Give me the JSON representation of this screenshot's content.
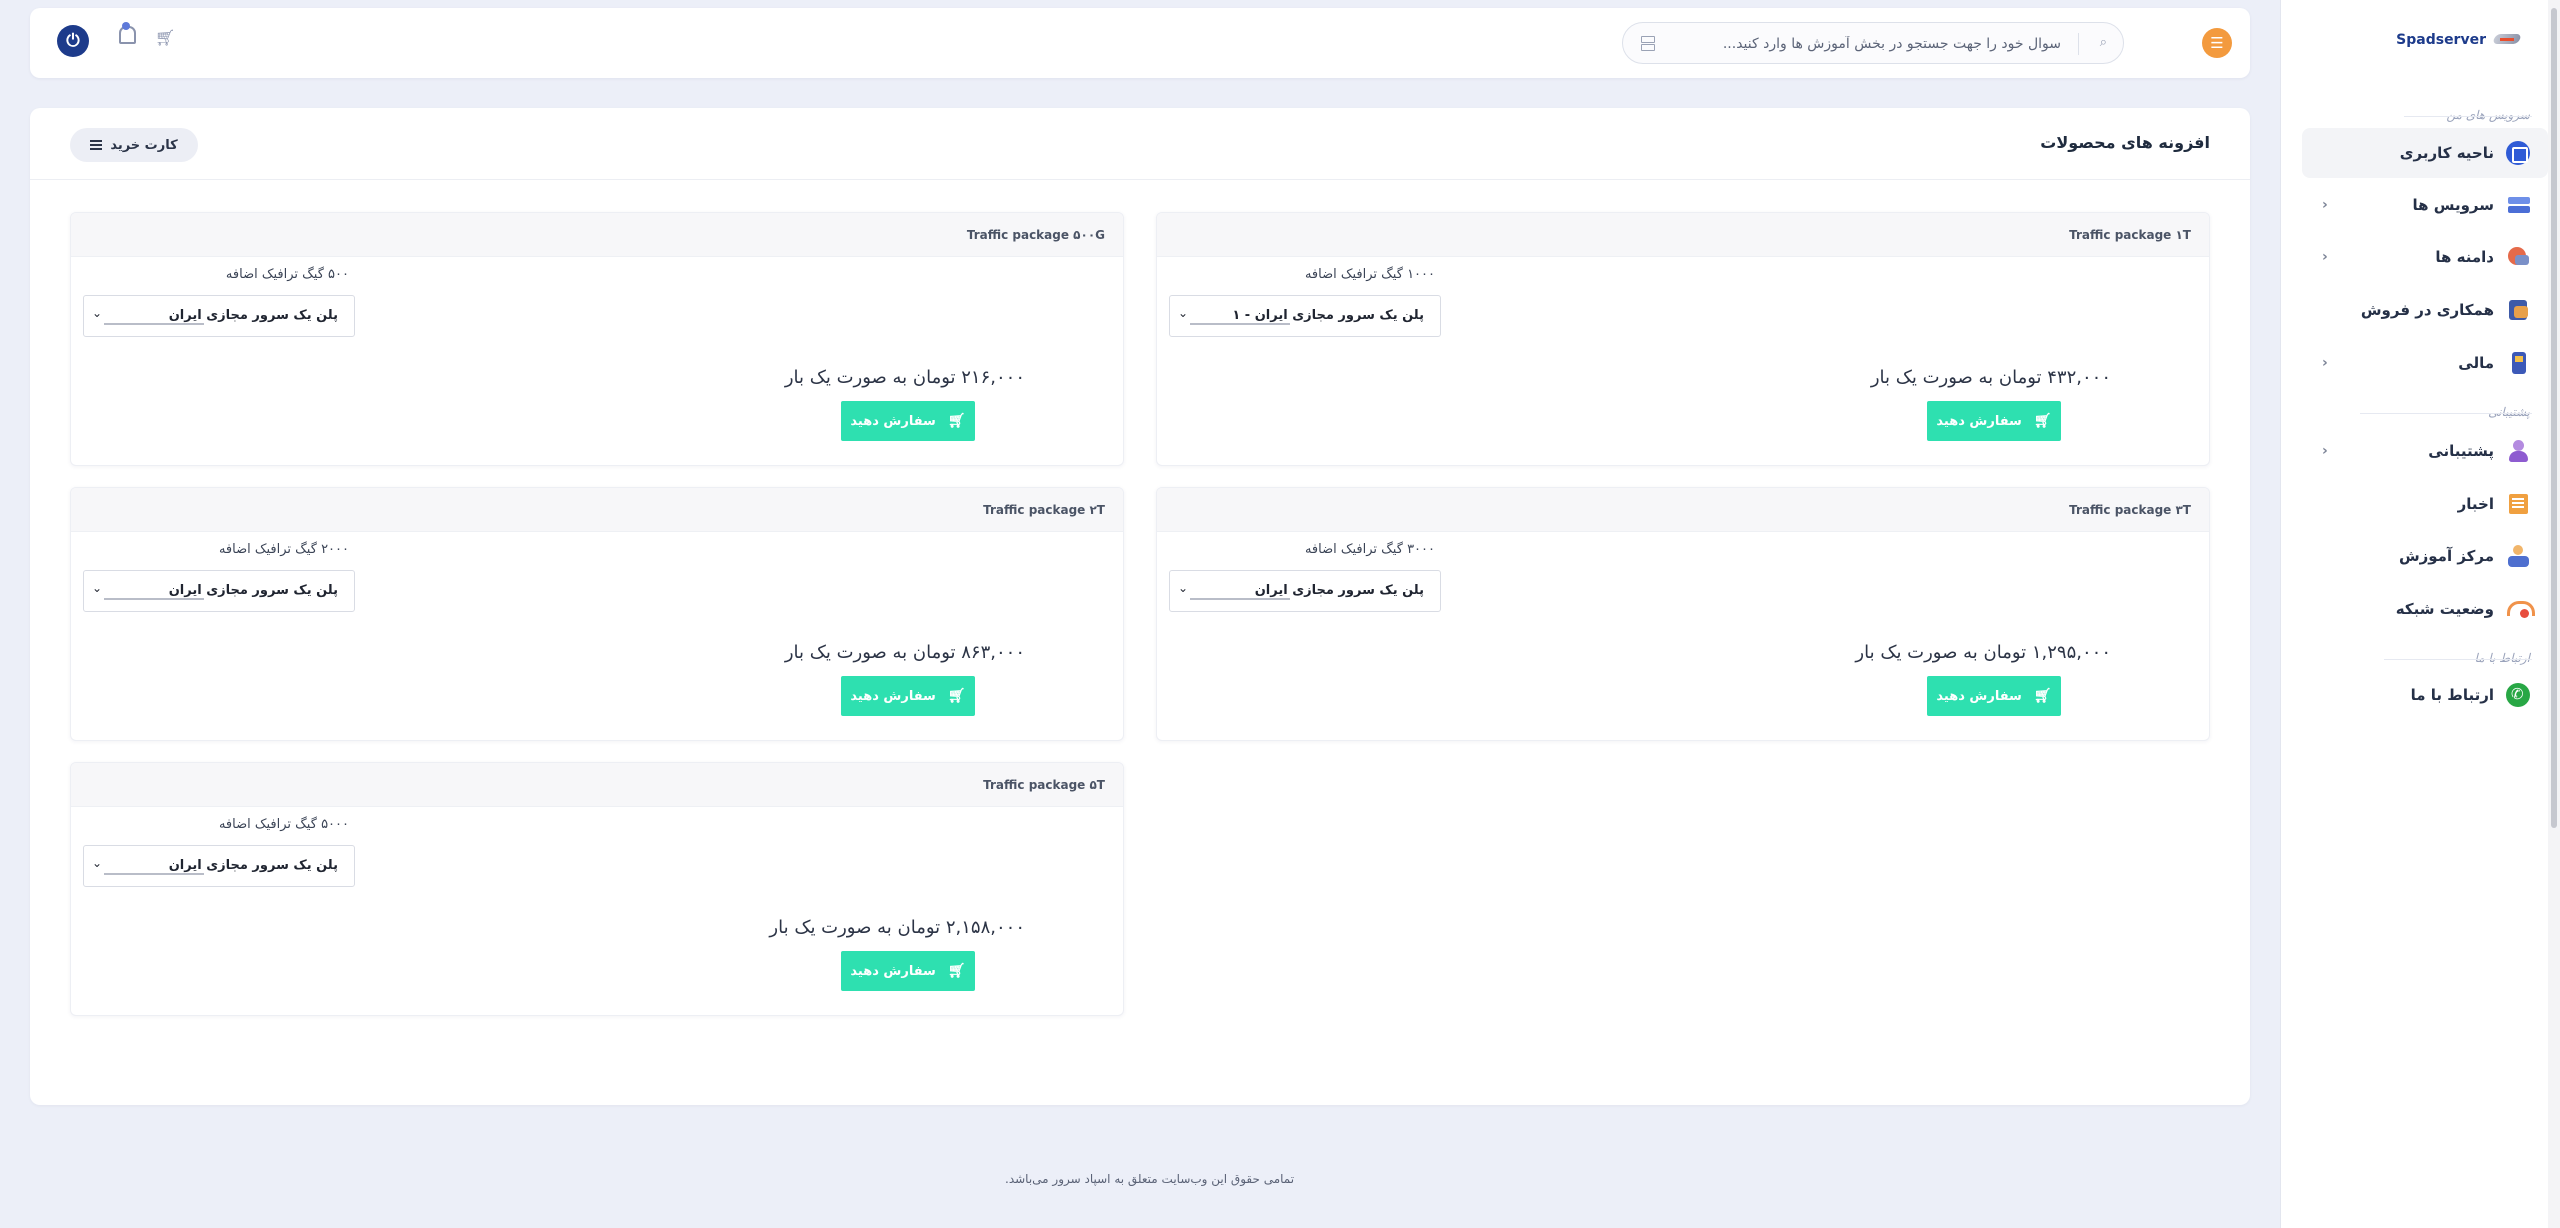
{
  "header": {
    "search_placeholder": "سوال خود را جهت جستجو در بخش آموزش ها وارد کنید...",
    "menu_icon": "menu-icon",
    "power_icon": "power-icon",
    "bell_icon": "bell-icon",
    "cart_icon": "cart-icon"
  },
  "sidebar": {
    "brand": "Spadserver",
    "sections": {
      "my_services": "سرویس های من",
      "support": "پشتیبانی",
      "contact": "ارتباط با ما"
    },
    "items": [
      {
        "label": "ناحیه کاربری",
        "icon": "home-icon",
        "active": true
      },
      {
        "label": "سرویس ها",
        "icon": "server-icon",
        "has_children": true
      },
      {
        "label": "دامنه ها",
        "icon": "domain-icon",
        "has_children": true
      },
      {
        "label": "همکاری در فروش",
        "icon": "partner-icon"
      },
      {
        "label": "مالی",
        "icon": "finance-icon",
        "has_children": true
      },
      {
        "label": "پشتیبانی",
        "icon": "support-icon",
        "has_children": true
      },
      {
        "label": "اخبار",
        "icon": "news-icon"
      },
      {
        "label": "مرکز آموزش",
        "icon": "education-icon"
      },
      {
        "label": "وضعیت شبکه",
        "icon": "network-status-icon"
      },
      {
        "label": "ارتباط با ما",
        "icon": "phone-icon"
      }
    ]
  },
  "main": {
    "title": "افزونه های محصولات",
    "cart_button": "کارت خرید",
    "order_label": "سفارش دهید",
    "products": [
      {
        "name": "Traffic package ۱T",
        "desc": "۱۰۰۰ گیگ ترافیک اضافه",
        "select": "پلن یک سرور مجازی ایران - ۱",
        "price": "۴۳۲,۰۰۰ تومان به صورت یک بار"
      },
      {
        "name": "Traffic package ۵۰۰G",
        "desc": "۵۰۰ گیگ ترافیک اضافه",
        "select": "پلن یک سرور مجازی ایران",
        "price": "۲۱۶,۰۰۰ تومان به صورت یک بار"
      },
      {
        "name": "Traffic package ۳T",
        "desc": "۳۰۰۰ گیگ ترافیک اضافه",
        "select": "پلن یک سرور مجازی ایران",
        "price": "۱,۲۹۵,۰۰۰ تومان به صورت یک بار"
      },
      {
        "name": "Traffic package ۲T",
        "desc": "۲۰۰۰ گیگ ترافیک اضافه",
        "select": "پلن یک سرور مجازی ایران",
        "price": "۸۶۳,۰۰۰ تومان به صورت یک بار"
      },
      {
        "name": "Traffic package ۵T",
        "desc": "۵۰۰۰ گیگ ترافیک اضافه",
        "select": "پلن یک سرور مجازی ایران",
        "price": "۲,۱۵۸,۰۰۰ تومان به صورت یک بار"
      }
    ]
  },
  "footer": {
    "copyright": "تمامی حقوق این وب‌سایت متعلق به اسپاد سرور می‌باشد."
  },
  "colors": {
    "accent": "#2ee0b0",
    "brand": "#1d3b8b",
    "menu": "#f39a3e"
  }
}
